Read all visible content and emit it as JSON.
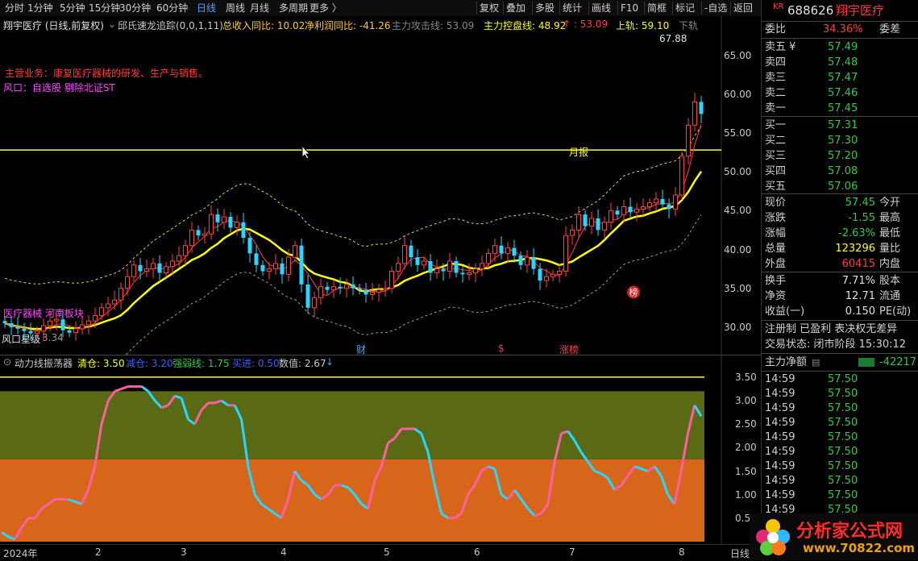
{
  "toolbar": {
    "periods": [
      "分时",
      "1分钟",
      "5分钟",
      "15分钟",
      "30分钟",
      "60分钟",
      "日线",
      "周线",
      "月线",
      "多周期",
      "更多 〉"
    ],
    "active_period": "日线",
    "tools": [
      "复权",
      "叠加",
      "多股",
      "统计",
      "画线",
      "F10",
      "简框",
      "标记",
      "-自选",
      "返回"
    ]
  },
  "header": {
    "stock": "翔宇医疗 (日线,前复权)",
    "indicator": "邱氏速龙追踪(0,0,1,11)",
    "items": [
      {
        "label": "总收入同比: 10.02",
        "color": "#ffcc33"
      },
      {
        "label": "净利润同比: -41.26",
        "color": "#ffcc33"
      },
      {
        "label": "主力攻击线: 53.09",
        "color": "#888888"
      },
      {
        "label": "主力控盘线: 48.92",
        "color": "#ffff00"
      },
      {
        "label": "↑ : 53.09",
        "color": "#ff3c3c"
      },
      {
        "label": "上轨: 59.10",
        "color": "#ffff00"
      },
      {
        "label": "下轨",
        "color": "#888888"
      }
    ]
  },
  "annotations": {
    "main_business": "主营业务：康复医疗器械的研发、生产与销售。",
    "wind": "风口：自选股 剔除北证ST",
    "sector": "医疗器械 河南板块",
    "star": "风口星级",
    "star_val": "3.34",
    "peak": "67.88",
    "yuebao": "月报",
    "bang": "榜",
    "cai": "财",
    "s": "$",
    "zhangbang": "涨榜"
  },
  "price_axis": [
    "65.00",
    "60.00",
    "55.00",
    "50.00",
    "45.00",
    "40.00",
    "35.00",
    "30.00"
  ],
  "indicator_header": {
    "name": "动力线振荡器",
    "items": [
      {
        "label": "清仓: 3.50",
        "color": "#ffff00"
      },
      {
        "label": "减仓: 3.20",
        "color": "#3a5fff"
      },
      {
        "label": "强弱线: 1.75",
        "color": "#2ecc40"
      },
      {
        "label": "买进: 0.50",
        "color": "#3a5fff"
      },
      {
        "label": "数值: 2.67",
        "color": "#c8c8c8"
      }
    ]
  },
  "ind_axis": [
    "3.50",
    "3.00",
    "2.50",
    "2.00",
    "1.50",
    "1.00",
    "0.5"
  ],
  "x_axis": [
    "2024年",
    "2",
    "3",
    "4",
    "5",
    "6",
    "7",
    "8"
  ],
  "bottom_tab": "日线",
  "quote": {
    "code_tag": "KR",
    "code": "688626",
    "name": "翔宇医疗",
    "weibi_label": "委比",
    "weibi": "34.36%",
    "weicha_label": "委差",
    "asks": [
      {
        "label": "卖五 ¥",
        "price": "57.49"
      },
      {
        "label": "卖四",
        "price": "57.48"
      },
      {
        "label": "卖三",
        "price": "57.47"
      },
      {
        "label": "卖二",
        "price": "57.46"
      },
      {
        "label": "卖一",
        "price": "57.45"
      }
    ],
    "bids": [
      {
        "label": "买一",
        "price": "57.31"
      },
      {
        "label": "买二",
        "price": "57.30"
      },
      {
        "label": "买三",
        "price": "57.20"
      },
      {
        "label": "买四",
        "price": "57.08"
      },
      {
        "label": "买五",
        "price": "57.06"
      }
    ],
    "stats": [
      {
        "l": "现价",
        "v": "57.45",
        "vc": "g",
        "r": "今开"
      },
      {
        "l": "涨跌",
        "v": "-1.55",
        "vc": "g",
        "r": "最高"
      },
      {
        "l": "涨幅",
        "v": "-2.63%",
        "vc": "g",
        "r": "最低"
      },
      {
        "l": "总量",
        "v": "123296",
        "vc": "y",
        "r": "量比"
      },
      {
        "l": "外盘",
        "v": "60415",
        "vc": "r",
        "r": "内盘"
      }
    ],
    "stats2": [
      {
        "l": "换手",
        "v": "7.71%",
        "r": "股本"
      },
      {
        "l": "净资",
        "v": "12.71",
        "r": "流通"
      },
      {
        "l": "收益(一)",
        "v": "0.150",
        "r": "PE(动)"
      }
    ],
    "register": "注册制 已盈利 表决权无差异",
    "status": "交易状态: 闭市阶段 15:30:12",
    "net_label": "主力净额",
    "net_value": "-42217",
    "ticks": [
      {
        "t": "14:59",
        "p": "57.50"
      },
      {
        "t": "14:59",
        "p": "57.50"
      },
      {
        "t": "14:59",
        "p": "57.50"
      },
      {
        "t": "14:59",
        "p": "57.50"
      },
      {
        "t": "14:59",
        "p": "57.50"
      },
      {
        "t": "14:59",
        "p": "57.50"
      },
      {
        "t": "14:59",
        "p": "57.50"
      },
      {
        "t": "14:59",
        "p": "57.50"
      },
      {
        "t": "14:59",
        "p": "57.50"
      },
      {
        "t": "14:59",
        "p": "57.50"
      }
    ]
  },
  "watermark": {
    "brand": "分析家公式网",
    "url": "www.70822.com"
  },
  "chart_data": {
    "type": "candlestick",
    "resistance": 52.8,
    "ylim": [
      27.5,
      69
    ],
    "closes": [
      30.5,
      30.0,
      29.8,
      29.5,
      29.2,
      29.5,
      30.2,
      30.8,
      31.0,
      29.6,
      29.3,
      29.8,
      30.3,
      30.8,
      31.5,
      32.5,
      33.0,
      33.5,
      35.0,
      36.5,
      38.0,
      37.2,
      37.5,
      38.2,
      37.0,
      37.8,
      38.5,
      39.2,
      40.5,
      42.5,
      41.8,
      42.0,
      44.5,
      43.5,
      44.2,
      42.8,
      43.5,
      41.5,
      39.5,
      38.0,
      37.2,
      37.5,
      38.2,
      36.8,
      39.0,
      40.5,
      35.5,
      32.5,
      33.8,
      35.2,
      34.8,
      35.2,
      35.0,
      35.5,
      35.0,
      34.8,
      34.2,
      34.5,
      34.8,
      35.0,
      37.2,
      38.2,
      40.5,
      39.0,
      38.0,
      38.5,
      37.0,
      37.5,
      37.2,
      38.5,
      37.0,
      36.8,
      37.0,
      37.5,
      38.2,
      39.5,
      40.5,
      39.5,
      40.2,
      39.2,
      38.0,
      39.0,
      37.5,
      36.0,
      36.5,
      36.8,
      37.2,
      41.8,
      42.5,
      44.5,
      43.0,
      44.0,
      42.5,
      43.5,
      45.0,
      44.5,
      45.5,
      44.8,
      45.2,
      45.5,
      46.0,
      46.5,
      45.8,
      45.2,
      47.0,
      52.0,
      56.0,
      59.0,
      57.45
    ],
    "bands": {
      "upper_start": 38.5,
      "lower_start": 29.5
    }
  },
  "osc_data": {
    "values": [
      0.2,
      0.1,
      0.05,
      0.3,
      0.5,
      0.5,
      0.7,
      0.8,
      0.9,
      0.9,
      0.9,
      0.85,
      0.8,
      1.1,
      1.6,
      2.5,
      3.0,
      3.2,
      3.25,
      3.3,
      3.3,
      3.3,
      3.2,
      3.0,
      2.85,
      2.9,
      3.1,
      3.05,
      2.6,
      2.5,
      2.8,
      2.95,
      2.95,
      3.0,
      2.9,
      2.9,
      2.6,
      1.6,
      1.0,
      0.8,
      0.7,
      0.6,
      0.5,
      0.9,
      1.5,
      1.3,
      1.2,
      1.0,
      0.9,
      1.0,
      1.2,
      1.2,
      1.15,
      1.0,
      0.8,
      0.7,
      1.3,
      1.6,
      2.1,
      2.2,
      2.4,
      2.4,
      2.4,
      2.3,
      1.9,
      1.2,
      0.6,
      0.5,
      0.5,
      0.6,
      1.0,
      1.2,
      1.5,
      1.6,
      1.55,
      1.0,
      0.9,
      1.1,
      0.9,
      0.7,
      0.55,
      0.6,
      0.8,
      1.7,
      2.3,
      2.35,
      2.15,
      1.9,
      1.7,
      1.5,
      1.45,
      1.35,
      1.1,
      1.2,
      1.4,
      1.6,
      1.55,
      1.5,
      1.6,
      1.4,
      1.0,
      0.8,
      1.5,
      2.3,
      2.9,
      2.67
    ],
    "ylim": [
      0.0,
      3.6
    ]
  }
}
